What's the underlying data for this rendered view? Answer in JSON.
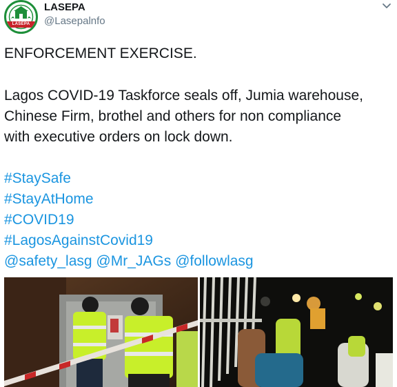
{
  "account": {
    "name": "LASEPA",
    "handle": "@Lasepalnfo",
    "avatar_icon": "lasepa-logo-icon",
    "avatar_badge_text": "LASEPA",
    "brand_green": "#1e8f3a",
    "brand_red": "#c8242b"
  },
  "menu": {
    "icon": "chevron-down-icon"
  },
  "tweet": {
    "headline": "ENFORCEMENT EXERCISE.",
    "body_lines": [
      "Lagos COVID-19 Taskforce seals off, Jumia warehouse,",
      "Chinese Firm, brothel and others for non compliance",
      "with executive orders on lock down."
    ],
    "hashtags": [
      "#StaySafe",
      "#StayAtHome",
      "#COVID19",
      "#LagosAgainstCovid19"
    ],
    "mentions": [
      "@safety_lasg",
      "@Mr_JAGs",
      "@followlasg"
    ],
    "link_color": "#1b95e0"
  },
  "media": [
    {
      "name": "photo-officials-sealing-door"
    },
    {
      "name": "photo-night-enforcement-crowd"
    }
  ]
}
